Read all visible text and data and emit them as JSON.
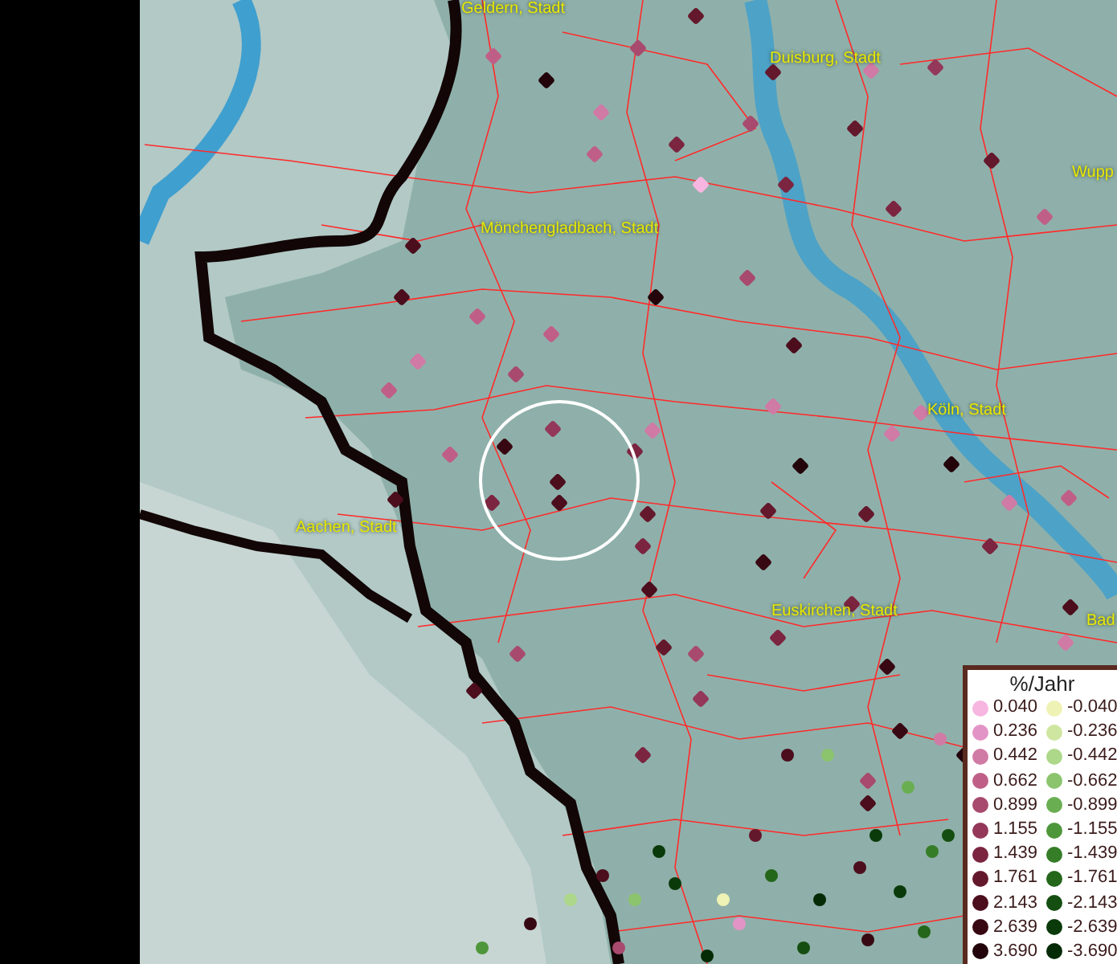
{
  "map": {
    "place_labels": [
      {
        "text": "Geldern, Stadt"
      },
      {
        "text": "Duisburg, Stadt"
      },
      {
        "text": "Wupp"
      },
      {
        "text": "Mönchengladbach, Stadt"
      },
      {
        "text": "Köln, Stadt"
      },
      {
        "text": "Aachen, Stadt"
      },
      {
        "text": "Euskirchen, Stadt"
      },
      {
        "text": "Bad"
      }
    ]
  },
  "legend": {
    "title": "%/Jahr",
    "left_column": [
      {
        "value": "0.040",
        "color": "#f6b6e0"
      },
      {
        "value": "0.236",
        "color": "#e394c6"
      },
      {
        "value": "0.442",
        "color": "#d07aa6"
      },
      {
        "value": "0.662",
        "color": "#bf5f88"
      },
      {
        "value": "0.899",
        "color": "#a84a6e"
      },
      {
        "value": "1.155",
        "color": "#94385a"
      },
      {
        "value": "1.439",
        "color": "#7b2540"
      },
      {
        "value": "1.761",
        "color": "#64182c"
      },
      {
        "value": "2.143",
        "color": "#4c0d1c"
      },
      {
        "value": "2.639",
        "color": "#380812"
      },
      {
        "value": "3.690",
        "color": "#22040a"
      }
    ],
    "right_column": [
      {
        "value": "-0.040",
        "color": "#eef2b4"
      },
      {
        "value": "-0.236",
        "color": "#cfe6a0"
      },
      {
        "value": "-0.442",
        "color": "#add88a"
      },
      {
        "value": "-0.662",
        "color": "#8cc46e"
      },
      {
        "value": "-0.899",
        "color": "#6aae52"
      },
      {
        "value": "-1.155",
        "color": "#4e963a"
      },
      {
        "value": "-1.439",
        "color": "#367d28"
      },
      {
        "value": "-1.761",
        "color": "#24661a"
      },
      {
        "value": "-2.143",
        "color": "#144e10"
      },
      {
        "value": "-2.639",
        "color": "#0a3a0a"
      },
      {
        "value": "-3.690",
        "color": "#052a06"
      }
    ]
  }
}
